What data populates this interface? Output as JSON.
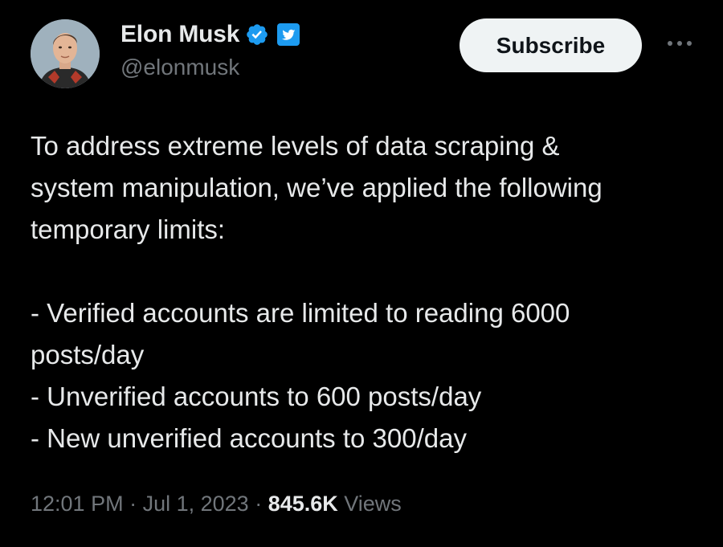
{
  "author": {
    "display_name": "Elon Musk",
    "handle": "@elonmusk",
    "avatar_icon": "profile-photo",
    "verified_icon": "verified-checkmark-icon",
    "affiliate_icon": "twitter-bird-badge-icon",
    "verified_color": "#1d9bf0"
  },
  "actions": {
    "subscribe_label": "Subscribe",
    "more_icon": "more-options-icon"
  },
  "tweet": {
    "lines": [
      "To address extreme levels of data scraping &",
      "system manipulation, we’ve applied the following",
      "temporary limits:",
      "",
      "- Verified accounts are limited to reading 6000",
      "posts/day",
      "- Unverified accounts to 600 posts/day",
      "- New unverified accounts to 300/day"
    ]
  },
  "meta": {
    "time": "12:01 PM",
    "separator_1": " · ",
    "date": "Jul 1, 2023",
    "separator_2": " · ",
    "views_count": "845.6K",
    "views_label": " Views"
  },
  "colors": {
    "background": "#000000",
    "text_primary": "#e7e9ea",
    "text_secondary": "#71767b",
    "button_bg": "#eff3f4",
    "accent": "#1d9bf0"
  }
}
